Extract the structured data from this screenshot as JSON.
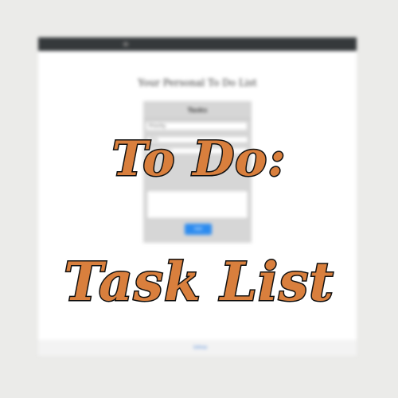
{
  "overlay": {
    "line1": "To Do:",
    "line2": "Task List"
  },
  "screenshot": {
    "page_heading": "Your Personal To Do List",
    "panel_title": "Tasks",
    "select_label": "Priority",
    "field1_placeholder": "Title",
    "field2_placeholder": "Description",
    "add_button": "Add",
    "footer_link": "GitHub"
  },
  "colors": {
    "overlay_text": "#d97f3d",
    "overlay_stroke": "#111111",
    "topbar": "#35393b",
    "button": "#2d8cf0"
  }
}
